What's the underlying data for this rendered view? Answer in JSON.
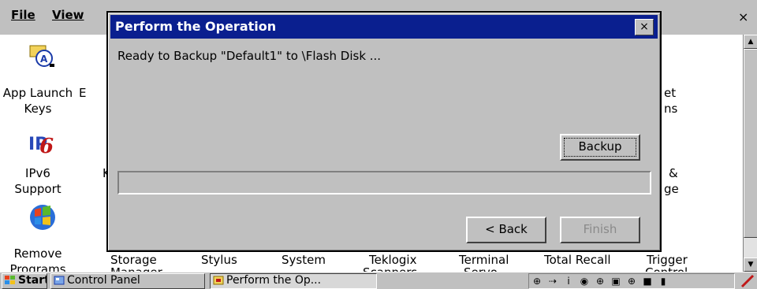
{
  "menubar": {
    "file": "File",
    "view": "View"
  },
  "icons": [
    {
      "label_line1": "App Launch",
      "label_line2": "Keys"
    },
    {
      "label_line1": "IPv6",
      "label_line2": "Support"
    },
    {
      "label_line1": "Remove",
      "label_line2": "Programs"
    }
  ],
  "partial_labels": {
    "col2_row1": "E",
    "col2_row2": "K",
    "col8_row1a": "et",
    "col8_row1b": "ns",
    "col8_row2a": "&",
    "col8_row2b": "ge",
    "bottom_row": [
      "Storage",
      "Stylus",
      "System",
      "Teklogix",
      "Terminal",
      "Total Recall",
      "Trigger"
    ],
    "bottom_row2": [
      "Manager",
      "Scanners",
      "Servo",
      "Control"
    ]
  },
  "dialog": {
    "title": "Perform the Operation",
    "close": "×",
    "status": "Ready to Backup \"Default1\" to \\Flash Disk ...",
    "backup_label": "Backup",
    "back_label": "< Back",
    "finish_label": "Finish",
    "progress": 0
  },
  "window_close": "×",
  "taskbar": {
    "start": "Start",
    "control_panel": "Control Panel",
    "perform": "Perform the Op..."
  },
  "colors": {
    "titlebar": "#0a1f8f",
    "face": "#c0c0c0"
  }
}
